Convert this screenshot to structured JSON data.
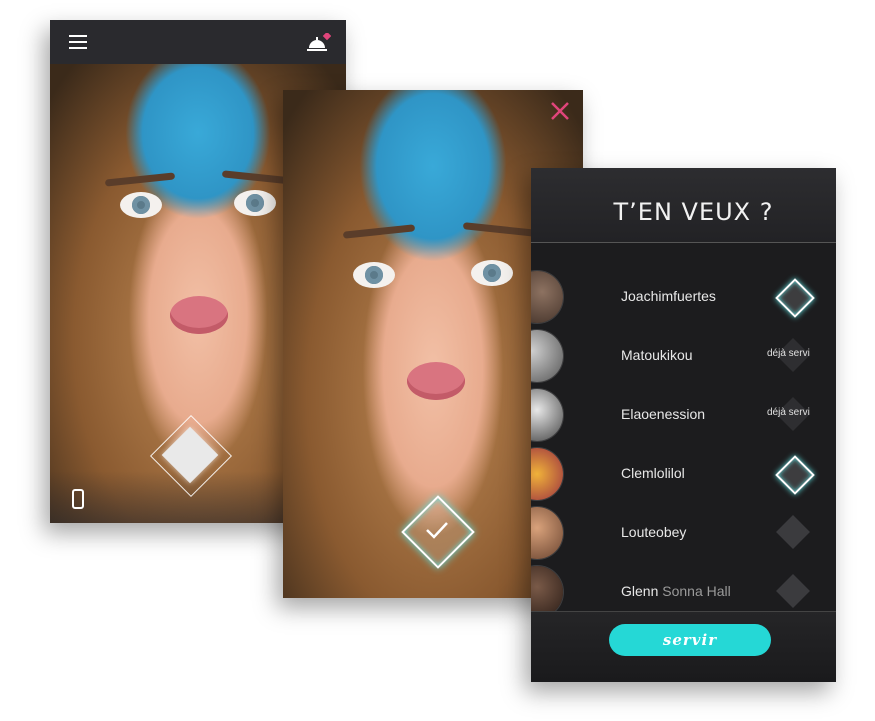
{
  "screen1": {
    "icons": {
      "menu": "hamburger-icon",
      "notify": "service-bell-icon",
      "phone": "phone-icon",
      "switch": "sync-icon"
    }
  },
  "screen2": {
    "icons": {
      "close": "close-icon",
      "confirm": "checkmark-icon"
    },
    "accent_color": "#e0457b"
  },
  "screen3": {
    "title": "T’EN VEUX ?",
    "friends": [
      {
        "first": "Joachimfuertes",
        "rest": "",
        "status": "selected",
        "note": ""
      },
      {
        "first": "Matoukikou",
        "rest": "",
        "status": "served",
        "note": "déjà servi"
      },
      {
        "first": "Elaoenession",
        "rest": "",
        "status": "served",
        "note": "déjà servi"
      },
      {
        "first": "Clemlolilol",
        "rest": "",
        "status": "selected",
        "note": ""
      },
      {
        "first": "Louteobey",
        "rest": "",
        "status": "unselected",
        "note": ""
      },
      {
        "first": "Glenn",
        "rest": " Sonna Hall",
        "status": "unselected",
        "note": ""
      }
    ],
    "button_label": "servir",
    "button_color": "#25d8d6"
  }
}
